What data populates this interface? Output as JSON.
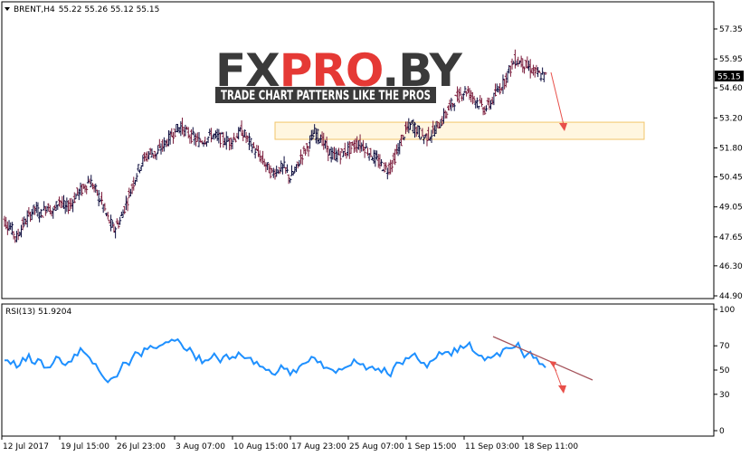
{
  "header": {
    "symbol": "BRENT,H4",
    "ohlc": "55.22 55.26 55.12 55.15",
    "dropdown_icon": "triangle-down-icon"
  },
  "indicator_label": "RSI(13) 51.9204",
  "price_badge": "55.15",
  "watermark": {
    "brand_fx": "FX",
    "brand_pro": "PRO",
    "brand_by": ".BY",
    "tagline": "TRADE CHART PATTERNS LIKE THE PROS"
  },
  "colors": {
    "candle_bull": "#0a0a3c",
    "candle_bear": "#7a1a3a",
    "rsi_line": "#1e90ff",
    "zone_fill": "#fff6e0",
    "zone_border": "#f2c46a",
    "arrow": "#e8504a",
    "trendline": "#a5545c",
    "watermark_dark": "#3a3a3a",
    "watermark_accent": "#e53935"
  },
  "chart_data": [
    {
      "type": "candlestick",
      "pane": "price",
      "symbol": "BRENT",
      "timeframe": "H4",
      "ylim": [
        44.9,
        58.0
      ],
      "y_ticks": [
        "57.35",
        "55.95",
        "54.60",
        "53.20",
        "51.80",
        "50.45",
        "49.05",
        "47.65",
        "46.30",
        "44.90"
      ],
      "x_ticks": [
        "12 Jul 2017",
        "19 Jul 15:00",
        "26 Jul 23:00",
        "3 Aug 07:00",
        "10 Aug 15:00",
        "17 Aug 23:00",
        "25 Aug 07:00",
        "1 Sep 15:00",
        "11 Sep 03:00",
        "18 Sep 11:00"
      ],
      "last_price": 55.15,
      "closes": [
        48.4,
        48.1,
        47.6,
        48.2,
        48.6,
        49.0,
        48.7,
        49.1,
        48.8,
        49.4,
        49.0,
        49.2,
        49.7,
        49.9,
        50.3,
        49.8,
        49.3,
        48.5,
        48.0,
        48.4,
        49.2,
        50.0,
        50.8,
        51.3,
        51.6,
        51.5,
        51.9,
        52.2,
        52.6,
        52.8,
        52.5,
        52.3,
        52.1,
        52.2,
        52.4,
        52.3,
        52.2,
        52.1,
        52.3,
        52.6,
        52.2,
        51.8,
        51.4,
        51.0,
        50.6,
        50.8,
        50.9,
        50.4,
        50.8,
        51.5,
        51.9,
        52.5,
        52.3,
        51.8,
        51.4,
        51.5,
        51.6,
        51.8,
        52.0,
        51.9,
        51.6,
        51.3,
        51.0,
        50.8,
        51.2,
        51.9,
        52.6,
        52.9,
        52.6,
        52.3,
        52.4,
        52.7,
        53.1,
        53.6,
        54.0,
        54.3,
        54.5,
        54.2,
        53.9,
        53.6,
        53.9,
        54.4,
        54.8,
        55.4,
        55.9,
        55.8,
        55.6,
        55.4,
        55.2,
        55.15
      ],
      "zone": {
        "price_top": 53.0,
        "price_bottom": 52.2
      },
      "annotation": "projected decline arrow toward the marked zone"
    },
    {
      "type": "line",
      "pane": "indicator",
      "name": "RSI(13)",
      "ylim": [
        0,
        100
      ],
      "y_ticks": [
        "100",
        "70",
        "50",
        "30",
        "0"
      ],
      "last_value": 51.9204,
      "values": [
        58,
        55,
        52,
        60,
        63,
        55,
        58,
        52,
        56,
        60,
        54,
        57,
        62,
        65,
        60,
        55,
        46,
        40,
        44,
        50,
        56,
        60,
        64,
        68,
        70,
        68,
        71,
        73,
        74,
        72,
        66,
        64,
        62,
        58,
        60,
        60,
        61,
        59,
        60,
        62,
        60,
        55,
        53,
        50,
        47,
        49,
        51,
        46,
        48,
        55,
        57,
        60,
        57,
        52,
        50,
        51,
        52,
        54,
        56,
        55,
        52,
        50,
        48,
        47,
        52,
        56,
        60,
        62,
        59,
        56,
        57,
        60,
        63,
        65,
        68,
        70,
        70,
        66,
        62,
        58,
        60,
        64,
        67,
        68,
        69,
        66,
        63,
        60,
        55,
        52
      ],
      "annotation": "descending trendline with downward arrow"
    }
  ]
}
